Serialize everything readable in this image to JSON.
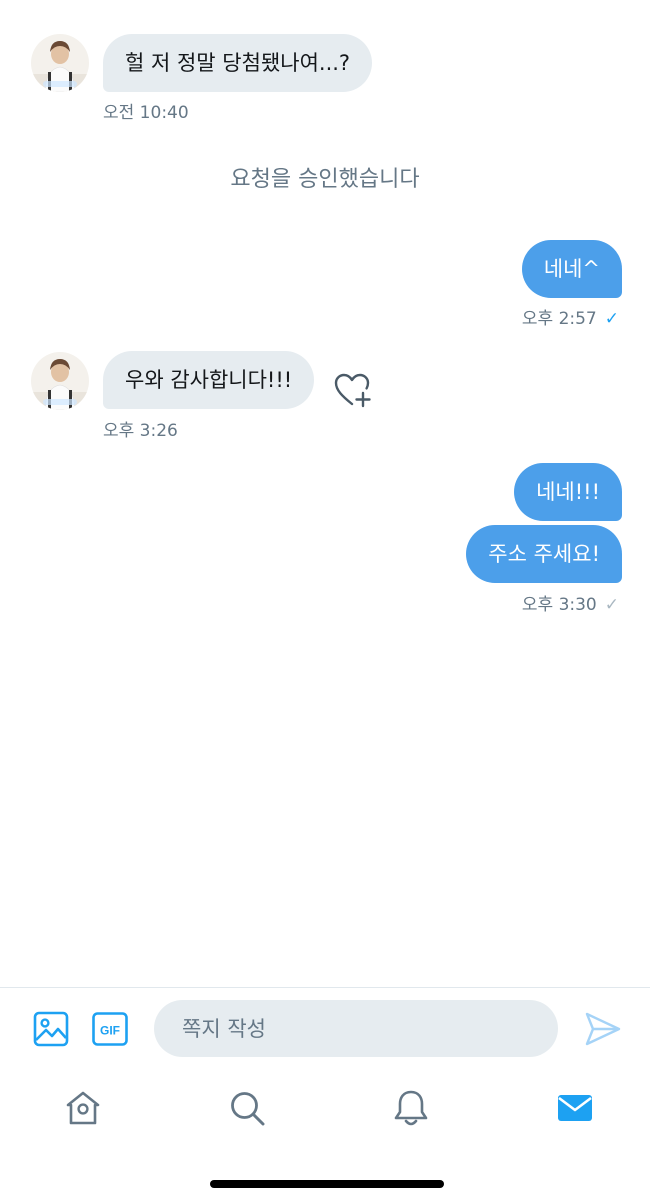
{
  "conversation": {
    "messages": [
      {
        "direction": "in",
        "text": "헐 저 정말 당첨됐나여...?",
        "time": "오전 10:40"
      },
      {
        "direction": "system",
        "text": "요청을 승인했습니다"
      },
      {
        "direction": "out",
        "text": "네네^",
        "time": "오후 2:57",
        "status": "✓"
      },
      {
        "direction": "in",
        "text": "우와 감사합니다!!!",
        "time": "오후 3:26"
      },
      {
        "direction": "out",
        "text": "네네!!!"
      },
      {
        "direction": "out",
        "text": "주소 주세요!",
        "time": "오후 3:30",
        "status": "✓"
      }
    ]
  },
  "composer": {
    "placeholder": "쪽지 작성",
    "icons": [
      "image-icon",
      "gif-icon",
      "send-icon"
    ]
  },
  "tabbar": {
    "items": [
      "home-icon",
      "search-icon",
      "notifications-icon",
      "messages-icon"
    ],
    "active": "messages-icon"
  },
  "colors": {
    "accent": "#1da1f2",
    "outgoing_bubble": "#4c9fea",
    "incoming_bubble": "#e6ecf0",
    "muted_text": "#657786"
  }
}
